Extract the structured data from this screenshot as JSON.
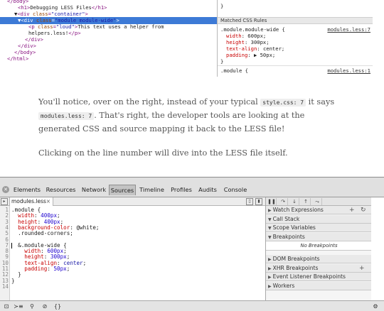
{
  "elements_tree": {
    "lines": [
      {
        "indent": 2,
        "parts": [
          [
            "tag",
            "</body>"
          ]
        ]
      },
      {
        "indent": 5,
        "parts": [
          [
            "tag",
            "<h1>"
          ],
          [
            "text",
            "Debugging LESS Files"
          ],
          [
            "tag",
            "</h1>"
          ]
        ]
      },
      {
        "indent": 4,
        "parts": [
          [
            "text",
            "▼"
          ],
          [
            "tag",
            "<div "
          ],
          [
            "attr",
            "class"
          ],
          [
            "tag",
            "="
          ],
          [
            "aval",
            "\"container\""
          ],
          [
            "tag",
            ">"
          ]
        ]
      },
      {
        "indent": 5,
        "selected": true,
        "parts": [
          [
            "text",
            "▼"
          ],
          [
            "tag",
            "<div "
          ],
          [
            "attr",
            "class"
          ],
          [
            "tag",
            "="
          ],
          [
            "aval",
            "\"module module-wide\""
          ],
          [
            "tag",
            ">"
          ]
        ]
      },
      {
        "indent": 8,
        "parts": [
          [
            "tag",
            "<p "
          ],
          [
            "attr",
            "class"
          ],
          [
            "tag",
            "="
          ],
          [
            "aval",
            "\"loud\""
          ],
          [
            "tag",
            ">"
          ],
          [
            "text",
            "This text uses a helper from"
          ]
        ]
      },
      {
        "indent": 8,
        "parts": [
          [
            "text",
            "helpers.less!"
          ],
          [
            "tag",
            "</p>"
          ]
        ]
      },
      {
        "indent": 7,
        "parts": [
          [
            "tag",
            "</div>"
          ]
        ]
      },
      {
        "indent": 5,
        "parts": [
          [
            "tag",
            "</div>"
          ]
        ]
      },
      {
        "indent": 4,
        "parts": [
          [
            "tag",
            "</body>"
          ]
        ]
      },
      {
        "indent": 2,
        "parts": [
          [
            "tag",
            "</html>"
          ]
        ]
      }
    ]
  },
  "styles_pane": {
    "brace": "}",
    "header": "Matched CSS Rules",
    "rule1": {
      "selector": ".module.module-wide {",
      "link": "modules.less:7",
      "props": [
        {
          "name": "width",
          "value": "600px;"
        },
        {
          "name": "height",
          "value": "300px;"
        },
        {
          "name": "text-align",
          "value": "center;"
        },
        {
          "name": "padding",
          "value": "▶ 50px;"
        }
      ],
      "close": "}"
    },
    "rule2": {
      "selector": ".module {",
      "link": "modules.less:1"
    }
  },
  "article": {
    "p1_a": "You'll notice, over on the right, instead of your typical ",
    "p1_code1": "style.css: 7",
    "p1_b": " it says ",
    "p1_code2": "modules.less: 7",
    "p1_c": ". That's right, the developer tools are looking at the generated CSS and source mapping it back to the LESS file!",
    "p2": "Clicking on the line number will dive into the LESS file itself."
  },
  "devtools": {
    "close_icon": "close-icon",
    "tabs": [
      "Elements",
      "Resources",
      "Network",
      "Sources",
      "Timeline",
      "Profiles",
      "Audits",
      "Console"
    ],
    "active_tab": "Sources",
    "open_file": "modules.less",
    "file_close": "×",
    "editor": {
      "lines": [
        {
          "n": "1",
          "parts": [
            [
              "sel",
              ".module {"
            ]
          ]
        },
        {
          "n": "2",
          "parts": [
            [
              "txt",
              "  "
            ],
            [
              "prop",
              "width"
            ],
            [
              "txt",
              ": "
            ],
            [
              "num",
              "400px"
            ],
            [
              "txt",
              ";"
            ]
          ]
        },
        {
          "n": "3",
          "parts": [
            [
              "txt",
              "  "
            ],
            [
              "prop",
              "height"
            ],
            [
              "txt",
              ": "
            ],
            [
              "num",
              "400px"
            ],
            [
              "txt",
              ";"
            ]
          ]
        },
        {
          "n": "4",
          "parts": [
            [
              "txt",
              "  "
            ],
            [
              "prop",
              "background-color"
            ],
            [
              "txt",
              ": @white;"
            ]
          ]
        },
        {
          "n": "5",
          "parts": [
            [
              "txt",
              "  .rounded-corners;"
            ]
          ]
        },
        {
          "n": "6",
          "parts": []
        },
        {
          "n": "7",
          "parts": [
            [
              "txt",
              "  &.module-wide {"
            ]
          ]
        },
        {
          "n": "8",
          "parts": [
            [
              "txt",
              "    "
            ],
            [
              "prop",
              "width"
            ],
            [
              "txt",
              ": "
            ],
            [
              "num",
              "600px"
            ],
            [
              "txt",
              ";"
            ]
          ]
        },
        {
          "n": "9",
          "parts": [
            [
              "txt",
              "    "
            ],
            [
              "prop",
              "height"
            ],
            [
              "txt",
              ": "
            ],
            [
              "num",
              "300px"
            ],
            [
              "txt",
              ";"
            ]
          ]
        },
        {
          "n": "10",
          "parts": [
            [
              "txt",
              "    "
            ],
            [
              "prop",
              "text-align"
            ],
            [
              "txt",
              ": "
            ],
            [
              "kw",
              "center"
            ],
            [
              "txt",
              ";"
            ]
          ]
        },
        {
          "n": "11",
          "parts": [
            [
              "txt",
              "    "
            ],
            [
              "prop",
              "padding"
            ],
            [
              "txt",
              ": "
            ],
            [
              "num",
              "50px"
            ],
            [
              "txt",
              ";"
            ]
          ]
        },
        {
          "n": "12",
          "parts": [
            [
              "txt",
              "  }"
            ]
          ]
        },
        {
          "n": "13",
          "parts": [
            [
              "txt",
              "}"
            ]
          ]
        },
        {
          "n": "14",
          "parts": []
        }
      ]
    },
    "sidebar": {
      "panes": [
        {
          "label": "Watch Expressions",
          "expanded": false,
          "actions": [
            "+",
            "↻"
          ]
        },
        {
          "label": "Call Stack",
          "expanded": true
        },
        {
          "label": "Scope Variables",
          "expanded": true
        },
        {
          "label": "Breakpoints",
          "expanded": true
        },
        {
          "label": "DOM Breakpoints",
          "expanded": false
        },
        {
          "label": "XHR Breakpoints",
          "expanded": false,
          "actions": [
            "+"
          ]
        },
        {
          "label": "Event Listener Breakpoints",
          "expanded": false
        },
        {
          "label": "Workers",
          "expanded": false
        }
      ],
      "no_breakpoints": "No Breakpoints"
    },
    "status_icons": [
      "dock-icon",
      "console-icon",
      "search-icon",
      "pause-exceptions-icon",
      "pretty-print-icon",
      "settings-icon"
    ],
    "status_glyphs": [
      "⊡",
      "≻≡",
      "⚲",
      "⊘",
      "{}",
      "⚙"
    ]
  },
  "colors": {
    "selection": "#3d7ad6",
    "tag": "#881280",
    "attr": "#994500",
    "css_prop": "#c80000",
    "css_num": "#1c00cf"
  }
}
